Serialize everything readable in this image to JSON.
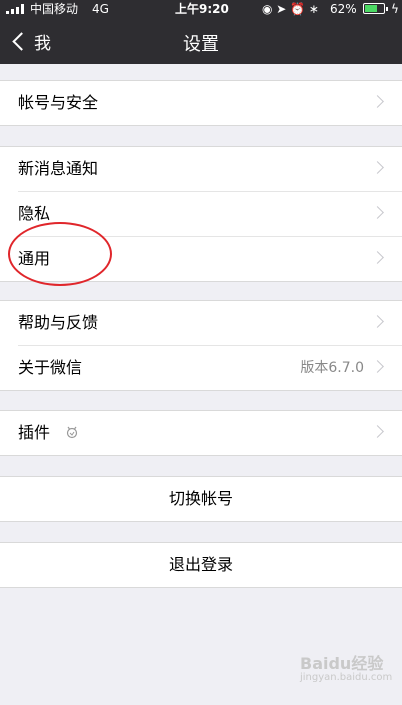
{
  "status_bar": {
    "carrier": "中国移动",
    "network": "4G",
    "time": "上午9:20",
    "battery": "62%",
    "battery_level": 0.62
  },
  "navbar": {
    "back_label": "我",
    "title": "设置"
  },
  "groups": [
    {
      "items": [
        {
          "label": "帐号与安全"
        }
      ]
    },
    {
      "items": [
        {
          "label": "新消息通知"
        },
        {
          "label": "隐私"
        },
        {
          "label": "通用"
        }
      ]
    },
    {
      "items": [
        {
          "label": "帮助与反馈"
        },
        {
          "label": "关于微信",
          "value": "版本6.7.0"
        }
      ]
    },
    {
      "items": [
        {
          "label": "插件"
        }
      ]
    }
  ],
  "buttons": {
    "switch_account": "切换帐号",
    "logout": "退出登录"
  },
  "watermark": {
    "brand": "Baidu经验",
    "url": "jingyan.baidu.com"
  }
}
